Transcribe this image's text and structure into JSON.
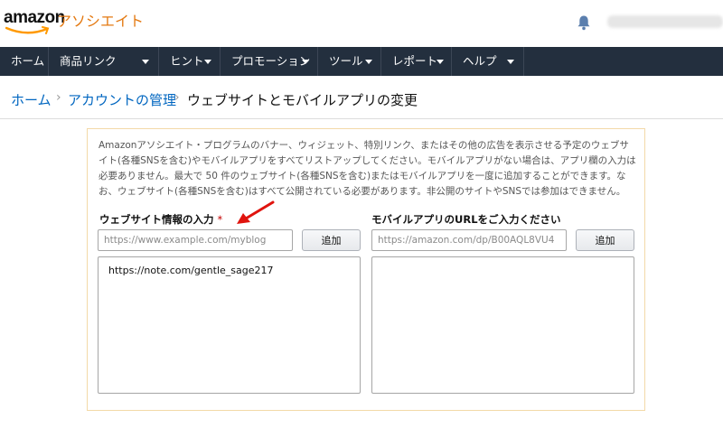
{
  "header": {
    "logo_word": "amazon",
    "logo_sub": "アソシエイト",
    "brand_color": "#e47911"
  },
  "nav": {
    "items": [
      {
        "label": "ホーム",
        "has_menu": false
      },
      {
        "label": "商品リンク",
        "has_menu": true
      },
      {
        "label": "ヒント",
        "has_menu": true
      },
      {
        "label": "プロモーション",
        "has_menu": true
      },
      {
        "label": "ツール",
        "has_menu": true
      },
      {
        "label": "レポート",
        "has_menu": true
      },
      {
        "label": "ヘルプ",
        "has_menu": true
      }
    ]
  },
  "breadcrumb": {
    "items": [
      "ホーム",
      "アカウントの管理",
      "ウェブサイトとモバイルアプリの変更"
    ],
    "separator": "›"
  },
  "panel": {
    "intro": "Amazonアソシエイト・プログラムのバナー、ウィジェット、特別リンク、またはその他の広告を表示させる予定のウェブサイト(各種SNSを含む)やモバイルアプリをすべてリストアップしてください。モバイルアプリがない場合は、アプリ欄の入力は必要ありません。最大で 50 件のウェブサイト(各種SNSを含む)またはモバイルアプリを一度に追加することができます。なお、ウェブサイト(各種SNSを含む)はすべて公開されている必要があります。非公開のサイトやSNSでは参加はできません。",
    "website": {
      "label": "ウェブサイト情報の入力",
      "required_mark": "*",
      "placeholder": "https://www.example.com/myblog",
      "value": "",
      "add_label": "追加",
      "entries": [
        "https://note.com/gentle_sage217"
      ]
    },
    "app": {
      "label": "モバイルアプリのURLをご入力ください",
      "placeholder": "https://amazon.com/dp/B00AQL8VU4",
      "value": "",
      "add_label": "追加",
      "entries": []
    }
  },
  "annotation": {
    "arrow_color": "#e0140e",
    "icon": "pointer-arrow-icon"
  },
  "colors": {
    "nav_bg": "#232f3e",
    "link": "#0066c0",
    "panel_border": "#f3d9a8"
  }
}
